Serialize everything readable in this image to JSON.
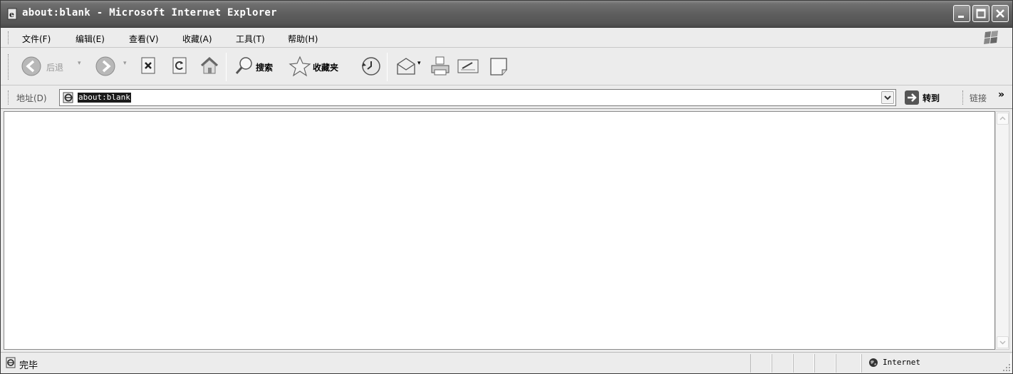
{
  "window": {
    "title": "about:blank - Microsoft Internet Explorer"
  },
  "menu": {
    "items": [
      "文件(F)",
      "编辑(E)",
      "查看(V)",
      "收藏(A)",
      "工具(T)",
      "帮助(H)"
    ]
  },
  "toolbar": {
    "back_label": "后退",
    "search_label": "搜索",
    "favorites_label": "收藏夹"
  },
  "address": {
    "label": "地址(D)",
    "value": "about:blank",
    "go_label": "转到",
    "links_label": "链接"
  },
  "status": {
    "text": "完毕",
    "zone": "Internet"
  },
  "icons": {
    "back": "back-arrow-icon",
    "forward": "forward-arrow-icon",
    "stop": "stop-icon",
    "refresh": "refresh-icon",
    "home": "home-icon",
    "search": "magnifier-icon",
    "favorites": "star-icon",
    "history": "history-icon",
    "mail": "mail-icon",
    "print": "printer-icon",
    "edit": "edit-icon",
    "discuss": "page-icon",
    "ie": "ie-page-icon",
    "zone": "globe-icon"
  }
}
